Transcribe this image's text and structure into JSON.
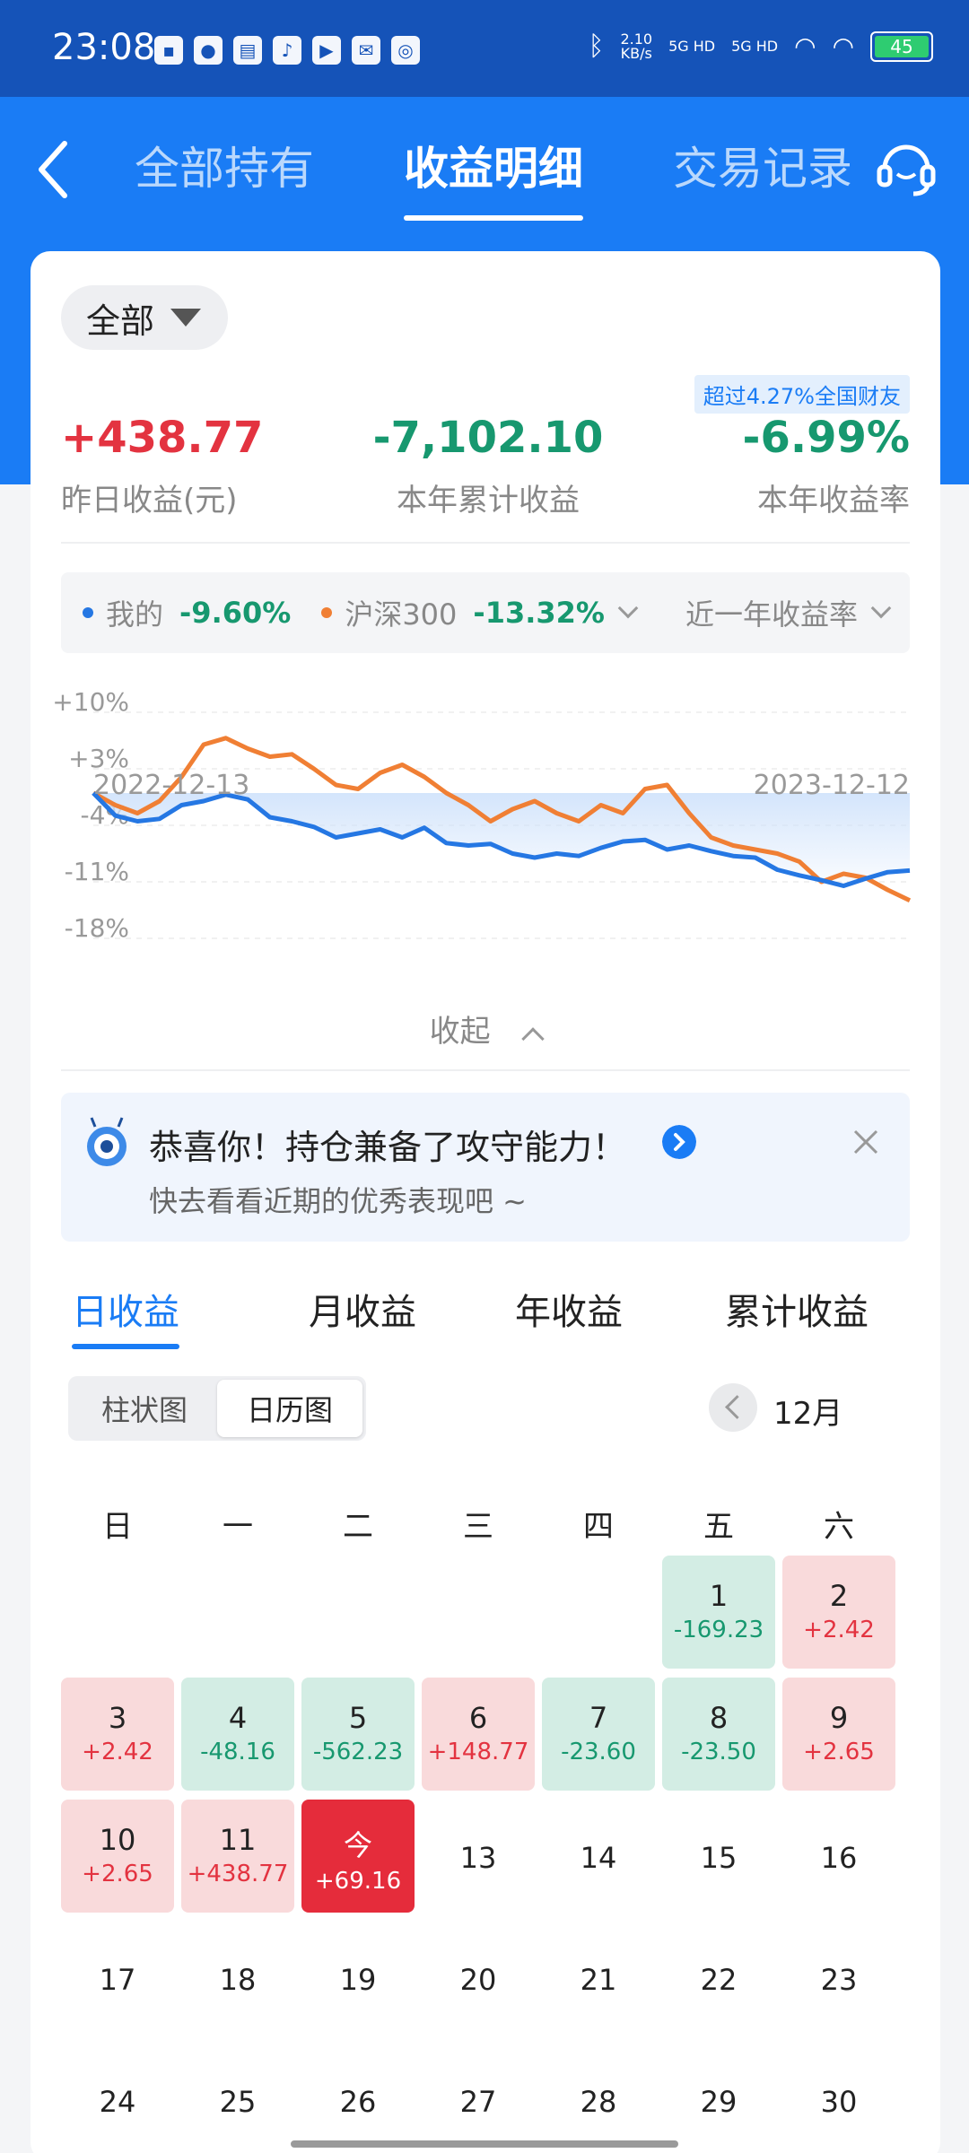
{
  "status_bar": {
    "time": "23:08",
    "net_speed_value": "2.10",
    "net_speed_unit": "KB/s",
    "sig1": "5G HD",
    "sig2": "5G HD",
    "battery": "45"
  },
  "header": {
    "tabs": [
      "全部持有",
      "收益明细",
      "交易记录"
    ],
    "active_tab": 1
  },
  "summary": {
    "filter_label": "全部",
    "beat_text": "超过4.27%全国财友",
    "yesterday_value": "+438.77",
    "yesterday_label": "昨日收益(元)",
    "year_profit_value": "-7,102.10",
    "year_profit_label": "本年累计收益",
    "year_rate_value": "-6.99%",
    "year_rate_label": "本年收益率"
  },
  "compare": {
    "mine_label": "我的",
    "mine_value": "-9.60%",
    "index_label": "沪深300",
    "index_value": "-13.32%",
    "period_label": "近一年收益率"
  },
  "chart_data": {
    "type": "line",
    "y_ticks": [
      "+10%",
      "+3%",
      "-4%",
      "-11%",
      "-18%"
    ],
    "ylim": [
      -18,
      10
    ],
    "x_start": "2022-12-13",
    "x_end": "2023-12-12",
    "series": [
      {
        "name": "我的",
        "color": "#2577e3",
        "values": [
          0,
          -2.8,
          -3.5,
          -3.2,
          -1.5,
          -1.0,
          -0.2,
          -0.8,
          -3.0,
          -3.5,
          -4.2,
          -5.5,
          -5.0,
          -4.5,
          -5.5,
          -4.3,
          -6.2,
          -6.5,
          -6.3,
          -7.5,
          -8.0,
          -7.5,
          -7.8,
          -6.8,
          -6.0,
          -5.8,
          -7.0,
          -6.5,
          -7.2,
          -7.8,
          -8.0,
          -9.5,
          -10.2,
          -10.8,
          -11.5,
          -10.6,
          -9.8,
          -9.6
        ]
      },
      {
        "name": "沪深300",
        "color": "#f07f34",
        "values": [
          0,
          -1.5,
          -2.5,
          -1.0,
          2.0,
          6.0,
          6.8,
          5.5,
          4.5,
          4.8,
          3.0,
          1.0,
          0.5,
          2.5,
          3.5,
          2.0,
          0,
          -1.5,
          -3.5,
          -2.0,
          -1.0,
          -2.5,
          -3.5,
          -1.5,
          -2.5,
          0.5,
          1.0,
          -2.5,
          -5.5,
          -6.5,
          -7.0,
          -7.5,
          -8.5,
          -11.0,
          -10.0,
          -10.5,
          -12.0,
          -13.3
        ]
      }
    ]
  },
  "collapse_label": "收起",
  "tip": {
    "title": "恭喜你！持仓兼备了攻守能力！",
    "subtitle": "快去看看近期的优秀表现吧 ~"
  },
  "profit_tabs": [
    "日收益",
    "月收益",
    "年收益",
    "累计收益"
  ],
  "view_toggle": [
    "柱状图",
    "日历图"
  ],
  "month_label": "12月",
  "weekdays": [
    "日",
    "一",
    "二",
    "三",
    "四",
    "五",
    "六"
  ],
  "calendar": [
    {
      "day": "1",
      "value": "-169.23",
      "trend": "down",
      "col": 5,
      "row": 0
    },
    {
      "day": "2",
      "value": "+2.42",
      "trend": "up",
      "col": 6,
      "row": 0
    },
    {
      "day": "3",
      "value": "+2.42",
      "trend": "up",
      "col": 0,
      "row": 1
    },
    {
      "day": "4",
      "value": "-48.16",
      "trend": "down",
      "col": 1,
      "row": 1
    },
    {
      "day": "5",
      "value": "-562.23",
      "trend": "down",
      "col": 2,
      "row": 1
    },
    {
      "day": "6",
      "value": "+148.77",
      "trend": "up",
      "col": 3,
      "row": 1
    },
    {
      "day": "7",
      "value": "-23.60",
      "trend": "down",
      "col": 4,
      "row": 1
    },
    {
      "day": "8",
      "value": "-23.50",
      "trend": "down",
      "col": 5,
      "row": 1
    },
    {
      "day": "9",
      "value": "+2.65",
      "trend": "up",
      "col": 6,
      "row": 1
    },
    {
      "day": "10",
      "value": "+2.65",
      "trend": "up",
      "col": 0,
      "row": 2
    },
    {
      "day": "11",
      "value": "+438.77",
      "trend": "up",
      "col": 1,
      "row": 2
    },
    {
      "day": "今",
      "value": "+69.16",
      "trend": "today",
      "col": 2,
      "row": 2
    },
    {
      "day": "13",
      "value": "",
      "trend": "plain",
      "col": 3,
      "row": 2
    },
    {
      "day": "14",
      "value": "",
      "trend": "plain",
      "col": 4,
      "row": 2
    },
    {
      "day": "15",
      "value": "",
      "trend": "plain",
      "col": 5,
      "row": 2
    },
    {
      "day": "16",
      "value": "",
      "trend": "plain",
      "col": 6,
      "row": 2
    },
    {
      "day": "17",
      "value": "",
      "trend": "plain",
      "col": 0,
      "row": 3
    },
    {
      "day": "18",
      "value": "",
      "trend": "plain",
      "col": 1,
      "row": 3
    },
    {
      "day": "19",
      "value": "",
      "trend": "plain",
      "col": 2,
      "row": 3
    },
    {
      "day": "20",
      "value": "",
      "trend": "plain",
      "col": 3,
      "row": 3
    },
    {
      "day": "21",
      "value": "",
      "trend": "plain",
      "col": 4,
      "row": 3
    },
    {
      "day": "22",
      "value": "",
      "trend": "plain",
      "col": 5,
      "row": 3
    },
    {
      "day": "23",
      "value": "",
      "trend": "plain",
      "col": 6,
      "row": 3
    },
    {
      "day": "24",
      "value": "",
      "trend": "plain",
      "col": 0,
      "row": 4
    },
    {
      "day": "25",
      "value": "",
      "trend": "plain",
      "col": 1,
      "row": 4
    },
    {
      "day": "26",
      "value": "",
      "trend": "plain",
      "col": 2,
      "row": 4
    },
    {
      "day": "27",
      "value": "",
      "trend": "plain",
      "col": 3,
      "row": 4
    },
    {
      "day": "28",
      "value": "",
      "trend": "plain",
      "col": 4,
      "row": 4
    },
    {
      "day": "29",
      "value": "",
      "trend": "plain",
      "col": 5,
      "row": 4
    },
    {
      "day": "30",
      "value": "",
      "trend": "plain",
      "col": 6,
      "row": 4
    }
  ]
}
